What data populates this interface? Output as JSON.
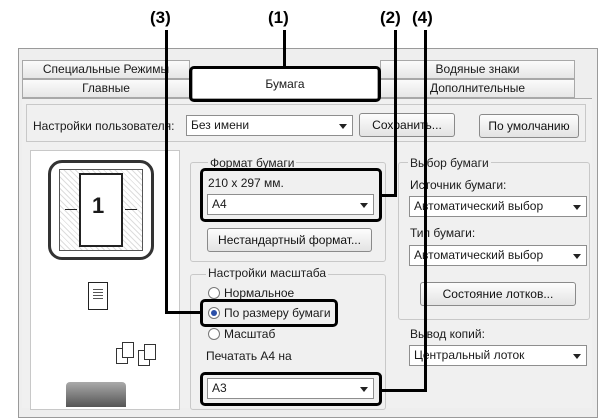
{
  "callouts": {
    "c1": "(1)",
    "c2": "(2)",
    "c3": "(3)",
    "c4": "(4)"
  },
  "tabs": {
    "special_modes": "Специальные Режимы",
    "main": "Главные",
    "paper": "Бумага",
    "watermarks": "Водяные знаки",
    "additional": "Дополнительные"
  },
  "user_settings": {
    "label": "Настройки пользователя:",
    "value": "Без имени",
    "save_button": "Сохранить...",
    "default_button": "По умолчанию"
  },
  "preview": {
    "page_number": "1"
  },
  "paper_format": {
    "title": "Формат бумаги",
    "size_text": "210 x 297 мм.",
    "value": "A4",
    "custom_button": "Нестандартный формат..."
  },
  "scaling": {
    "title": "Настройки масштаба",
    "options": [
      "Нормальное",
      "По размеру бумаги",
      "Масштаб"
    ],
    "selected": "По размеру бумаги",
    "print_label": "Печатать A4 на",
    "print_value": "A3"
  },
  "paper_selection": {
    "title": "Выбор бумаги",
    "source_label": "Источник бумаги:",
    "source_value": "Автоматический выбор",
    "type_label": "Тип бумаги:",
    "type_value": "Автоматический выбор",
    "tray_status_button": "Состояние лотков..."
  },
  "output": {
    "label": "Вывод копий:",
    "value": "Центральный лоток"
  }
}
